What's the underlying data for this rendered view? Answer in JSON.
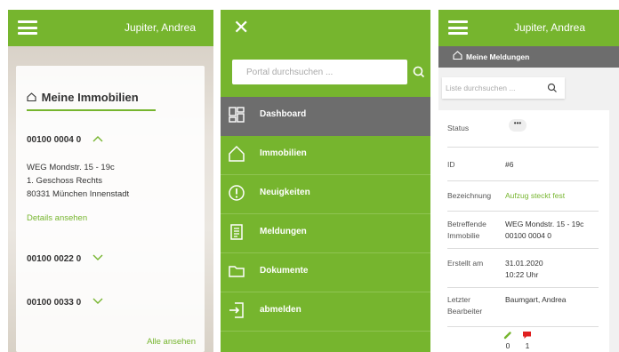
{
  "panel1": {
    "header": {
      "user": "Jupiter, Andrea"
    },
    "card": {
      "title": "Meine Immobilien",
      "properties": [
        {
          "id": "00100 0004 0",
          "expanded": true,
          "chevron": "chevron-up-icon"
        },
        {
          "id": "00100 0022 0",
          "expanded": false,
          "chevron": "chevron-down-icon"
        },
        {
          "id": "00100 0033 0",
          "expanded": false,
          "chevron": "chevron-down-icon"
        }
      ],
      "address": {
        "line1": "WEG Mondstr. 15 - 19c",
        "line2": "1. Geschoss Rechts",
        "line3": "80331 München Innenstadt"
      },
      "details_link": "Details ansehen",
      "all_link": "Alle ansehen"
    }
  },
  "panel2": {
    "search_placeholder": "Portal durchsuchen ...",
    "menu": [
      {
        "label": "Dashboard",
        "icon": "dashboard-icon",
        "active": true
      },
      {
        "label": "Immobilien",
        "icon": "house-icon",
        "active": false
      },
      {
        "label": "Neuigkeiten",
        "icon": "alert-circle-icon",
        "active": false
      },
      {
        "label": "Meldungen",
        "icon": "document-list-icon",
        "active": false
      },
      {
        "label": "Dokumente",
        "icon": "folder-icon",
        "active": false
      },
      {
        "label": "abmelden",
        "icon": "logout-icon",
        "active": false
      }
    ]
  },
  "panel3": {
    "header": {
      "user": "Jupiter, Andrea"
    },
    "subbar_title": "Meine Meldungen",
    "list_search_placeholder": "Liste durchsuchen ...",
    "rows": {
      "status": {
        "key": "Status",
        "value": "•••"
      },
      "id": {
        "key": "ID",
        "value": "#6"
      },
      "bezeichnung": {
        "key": "Bezeichnung",
        "value": "Aufzug steckt fest"
      },
      "immobilie": {
        "key1": "Betreffende",
        "key2": "Immobilie",
        "value1": "WEG Mondstr. 15 - 19c",
        "value2": "00100 0004 0"
      },
      "erstellt": {
        "key": "Erstellt am",
        "value1": "31.01.2020",
        "value2": "10:22 Uhr"
      },
      "bearbeiter": {
        "key1": "Letzter",
        "key2": "Bearbeiter",
        "value": "Baumgart, Andrea"
      }
    },
    "counts": {
      "attachments": "0",
      "comments": "1"
    }
  },
  "colors": {
    "brand_green": "#76b52e",
    "dark_gray": "#6d6d6d",
    "comment_red": "#e02020"
  }
}
